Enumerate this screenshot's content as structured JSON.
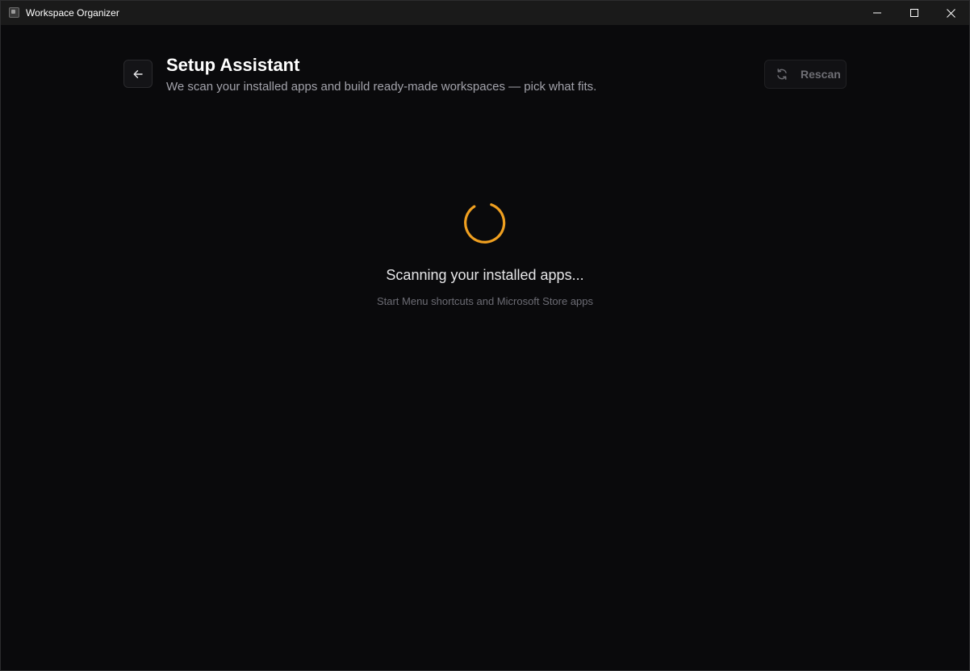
{
  "window": {
    "title": "Workspace Organizer"
  },
  "header": {
    "back_icon": "arrow-left-icon",
    "title": "Setup Assistant",
    "subtitle": "We scan your installed apps and build ready-made workspaces — pick what fits.",
    "rescan_label": "Rescan",
    "rescan_icon": "refresh-icon"
  },
  "loading": {
    "title": "Scanning your installed apps...",
    "subtitle": "Start Menu shortcuts and Microsoft Store apps",
    "spinner_color": "#f0a020"
  },
  "colors": {
    "background": "#0a0a0c",
    "titlebar": "#1a1a1a",
    "accent": "#f0a020"
  }
}
